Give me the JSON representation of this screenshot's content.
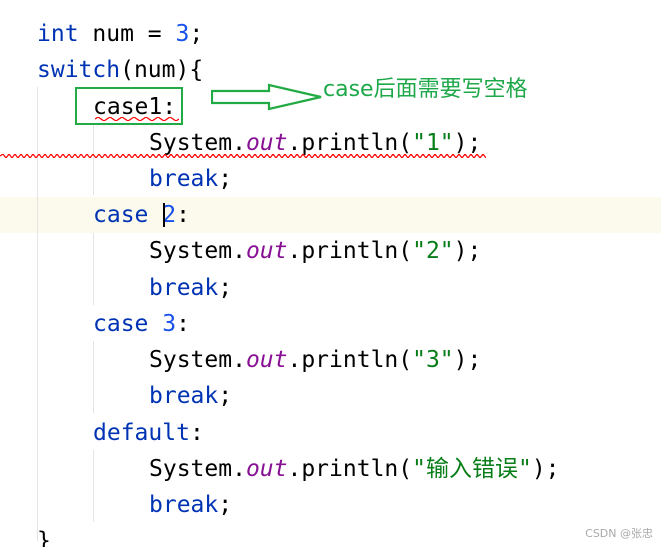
{
  "code_lines": [
    {
      "tokens": [
        {
          "text": "int",
          "kind": "kw"
        },
        {
          "text": " num = ",
          "kind": "plain"
        },
        {
          "text": "3",
          "kind": "num"
        },
        {
          "text": ";",
          "kind": "plain"
        }
      ]
    },
    {
      "tokens": [
        {
          "text": "switch",
          "kind": "kw"
        },
        {
          "text": "(num){",
          "kind": "plain"
        }
      ]
    },
    {
      "tokens": [
        {
          "text": "case1:",
          "kind": "plain"
        }
      ]
    },
    {
      "tokens": [
        {
          "text": "System.",
          "kind": "plain"
        },
        {
          "text": "out",
          "kind": "field"
        },
        {
          "text": ".println(",
          "kind": "plain"
        },
        {
          "text": "\"1\"",
          "kind": "str"
        },
        {
          "text": ");",
          "kind": "plain"
        }
      ]
    },
    {
      "tokens": [
        {
          "text": "break",
          "kind": "kw"
        },
        {
          "text": ";",
          "kind": "plain"
        }
      ]
    },
    {
      "tokens": [
        {
          "text": "case ",
          "kind": "kw"
        },
        {
          "text": "2",
          "kind": "num"
        },
        {
          "text": ":",
          "kind": "plain"
        }
      ]
    },
    {
      "tokens": [
        {
          "text": "System.",
          "kind": "plain"
        },
        {
          "text": "out",
          "kind": "field"
        },
        {
          "text": ".println(",
          "kind": "plain"
        },
        {
          "text": "\"2\"",
          "kind": "str"
        },
        {
          "text": ");",
          "kind": "plain"
        }
      ]
    },
    {
      "tokens": [
        {
          "text": "break",
          "kind": "kw"
        },
        {
          "text": ";",
          "kind": "plain"
        }
      ]
    },
    {
      "tokens": [
        {
          "text": "case ",
          "kind": "kw"
        },
        {
          "text": "3",
          "kind": "num"
        },
        {
          "text": ":",
          "kind": "plain"
        }
      ]
    },
    {
      "tokens": [
        {
          "text": "System.",
          "kind": "plain"
        },
        {
          "text": "out",
          "kind": "field"
        },
        {
          "text": ".println(",
          "kind": "plain"
        },
        {
          "text": "\"3\"",
          "kind": "str"
        },
        {
          "text": ");",
          "kind": "plain"
        }
      ]
    },
    {
      "tokens": [
        {
          "text": "break",
          "kind": "kw"
        },
        {
          "text": ";",
          "kind": "plain"
        }
      ]
    },
    {
      "tokens": [
        {
          "text": "default",
          "kind": "kw"
        },
        {
          "text": ":",
          "kind": "plain"
        }
      ]
    },
    {
      "tokens": [
        {
          "text": "System.",
          "kind": "plain"
        },
        {
          "text": "out",
          "kind": "field"
        },
        {
          "text": ".println(",
          "kind": "plain"
        },
        {
          "text": "\"输入错误\"",
          "kind": "str"
        },
        {
          "text": ");",
          "kind": "plain"
        }
      ]
    },
    {
      "tokens": [
        {
          "text": "break",
          "kind": "kw"
        },
        {
          "text": ";",
          "kind": "plain"
        }
      ]
    },
    {
      "tokens": [
        {
          "text": "}",
          "kind": "plain"
        }
      ]
    }
  ],
  "annotation": {
    "text": "case后面需要写空格",
    "color": "#1fa84a"
  },
  "watermark": "CSDN @张忠",
  "colors": {
    "keyword": "#0033b3",
    "number": "#1750eb",
    "string": "#067d17",
    "field": "#871094",
    "error_underline": "#ff0000",
    "current_line": "#fcfaed"
  }
}
